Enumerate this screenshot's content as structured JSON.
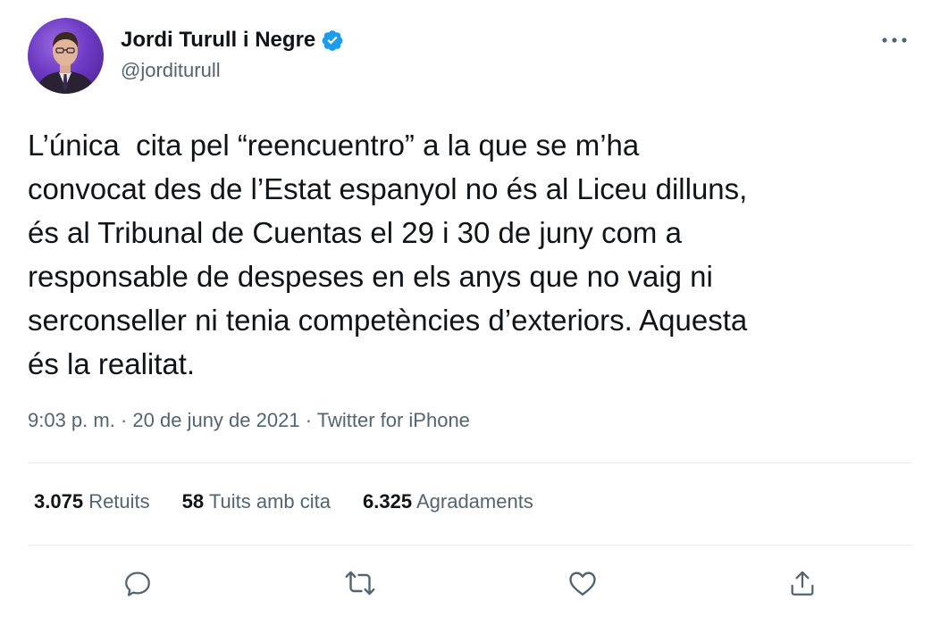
{
  "author": {
    "display_name": "Jordi Turull i Negre",
    "handle": "@jorditurull",
    "verified": true
  },
  "tweet": {
    "text": "L’única  cita pel “reencuentro” a la que se m’ha\nconvocat des de l’Estat espanyol no és al Liceu dilluns,\nés al Tribunal de Cuentas el 29 i 30 de juny com a\nresponsable de despeses en els anys que no vaig ni\nserconseller ni tenia competències d’exteriors. Aquesta\nés la realitat."
  },
  "meta": {
    "time": "9:03 p. m.",
    "separator": " · ",
    "date": "20 de juny de 2021",
    "source": "Twitter for iPhone"
  },
  "stats": {
    "retweets": {
      "count": "3.075",
      "label": "Retuits"
    },
    "quotes": {
      "count": "58",
      "label": "Tuits amb cita"
    },
    "likes": {
      "count": "6.325",
      "label": "Agradaments"
    }
  },
  "icons": {
    "more": "more-icon",
    "reply": "reply-icon",
    "retweet": "retweet-icon",
    "like": "like-icon",
    "share": "share-icon",
    "verified": "verified-badge-icon"
  },
  "colors": {
    "verified_blue": "#1d9bf0",
    "secondary_text": "#536471",
    "icon_gray": "#536471",
    "divider": "#e6ecf0"
  }
}
